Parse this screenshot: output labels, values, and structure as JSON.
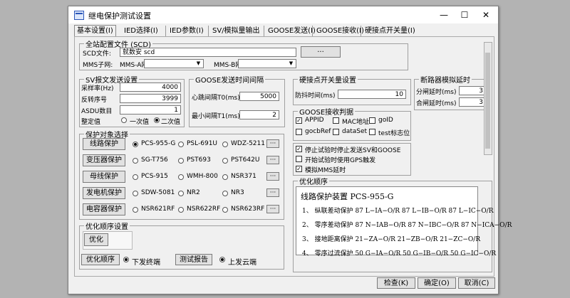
{
  "window": {
    "title": "继电保护测试设置",
    "min": "—",
    "max": "☐",
    "close": "✕"
  },
  "tabs": [
    "基本设置(I)",
    "IED选择(I)",
    "IED参数(I)",
    "SV/模拟量输出",
    "GOOSE发送(I)",
    "GOOSE接收(I)",
    "硬接点开关量(I)"
  ],
  "scd": {
    "group": "全站配置文件 (SCD)",
    "file_label": "SCD文件:",
    "file_value": "就数安 scd",
    "browse": "···",
    "mms_label": "MMS子网:",
    "mms_a_label": "MMS-A网",
    "mms_b_label": "MMS-B网"
  },
  "sv": {
    "group": "SV报文发送设置",
    "rate_label": "采样率(Hz)",
    "rate_value": "4000",
    "seq_label": "反转序号",
    "seq_value": "3999",
    "asdu_label": "ASDU数目",
    "asdu_value": "1",
    "set_label": "整定值",
    "opt1": "一次值",
    "opt2": "二次值"
  },
  "goose_interval": {
    "group": "GOOSE发送时间间隔",
    "t0_label": "心跳间隔T0(ms)",
    "t0_value": "5000",
    "t1_label": "最小间隔T1(ms)",
    "t1_value": "2"
  },
  "hard": {
    "group": "硬接点开关量设置",
    "label": "防抖时间(ms)",
    "value": "10"
  },
  "breaker": {
    "group": "断路器模拟延时",
    "open_label": "分闸延时(ms)",
    "open_value": "3",
    "close_label": "合闸延时(ms)",
    "close_value": "3"
  },
  "goose_recv": {
    "group": "GOOSE接收判据",
    "items": [
      {
        "label": "APPID",
        "checked": "✓"
      },
      {
        "label": "MAC地址",
        "checked": ""
      },
      {
        "label": "goID",
        "checked": ""
      },
      {
        "label": "gocbRef",
        "checked": ""
      },
      {
        "label": "dataSet",
        "checked": ""
      },
      {
        "label": "test标志位",
        "checked": ""
      }
    ]
  },
  "misc_checks": [
    {
      "label": "停止试验时停止发送SV和GOOSE",
      "checked": "✓"
    },
    {
      "label": "开始试验时使用GPS触发",
      "checked": ""
    },
    {
      "label": "模拟MMS延时",
      "checked": "✓"
    }
  ],
  "protect": {
    "group": "保护对象选择",
    "more": "···",
    "rows": [
      {
        "name": "线路保护",
        "opts": [
          "PCS-955-G",
          "PSL-691U",
          "WDZ-5211"
        ],
        "sel": 0
      },
      {
        "name": "变压器保护",
        "opts": [
          "SG-T756",
          "PST693",
          "PST642U"
        ],
        "sel": -1
      },
      {
        "name": "母线保护",
        "opts": [
          "PCS-915",
          "WMH-800",
          "NSR371"
        ],
        "sel": -1
      },
      {
        "name": "发电机保护",
        "opts": [
          "SDW-5081",
          "NR2",
          "NR3"
        ],
        "sel": -1
      },
      {
        "name": "电容器保护",
        "opts": [
          "NSR621RF",
          "NSR622RF",
          "NSR623RF"
        ],
        "sel": -1
      }
    ]
  },
  "order": {
    "group": "优化顺序设置",
    "opt_btn": "优化",
    "order_btn": "优化顺序",
    "down_label": "下发终端",
    "report_btn": "测试报告",
    "up_label": "上发云端"
  },
  "optlist": {
    "group": "优化顺序",
    "heading": "线路保护装置 PCS-955-G",
    "lines": [
      "1、 纵联差动保护 87 L−IA−O/R  87 L−IB−O/R  87 L−IC−O/R",
      "2、 零序差动保护 87 N−IAB−O/R  87 N−IBC−O/R  87 N−ICA−O/R",
      "3、 接地距离保护 21−ZA−O/R  21−ZB−O/R  21−ZC−O/R",
      "4、 零序过流保护 50 G−IA−O/R  50 G−IB−O/R  50 G−IC−O/R"
    ]
  },
  "footer": {
    "check": "检查(K)",
    "ok": "确定(O)",
    "cancel": "取消(C)"
  }
}
